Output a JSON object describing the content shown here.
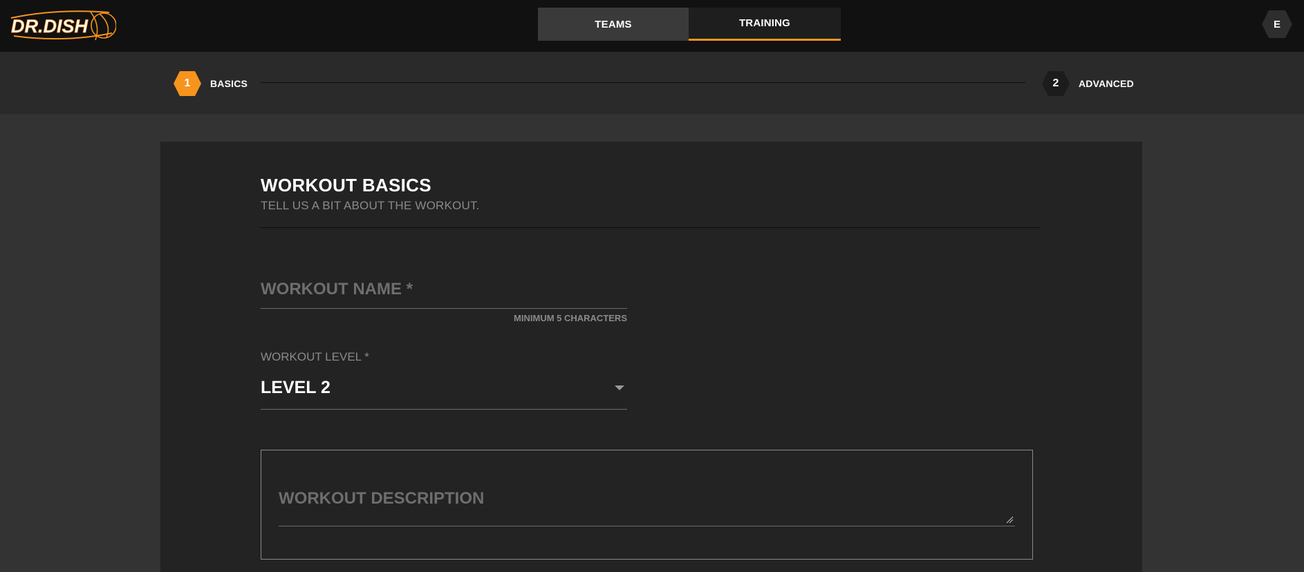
{
  "brand": {
    "logo_text": "DR.DISH",
    "accent_color": "#f7941d"
  },
  "nav": {
    "tabs": [
      {
        "label": "TEAMS",
        "active": false
      },
      {
        "label": "TRAINING",
        "active": true
      }
    ]
  },
  "user": {
    "avatar_initial": "E"
  },
  "stepper": {
    "steps": [
      {
        "number": "1",
        "label": "BASICS",
        "active": true
      },
      {
        "number": "2",
        "label": "ADVANCED",
        "active": false
      }
    ]
  },
  "form": {
    "title": "WORKOUT BASICS",
    "subtitle": "TELL US A BIT ABOUT THE WORKOUT.",
    "workout_name": {
      "placeholder": "WORKOUT NAME *",
      "value": "",
      "hint": "MINIMUM 5 CHARACTERS"
    },
    "workout_level": {
      "label": "WORKOUT LEVEL *",
      "value": "LEVEL 2"
    },
    "workout_description": {
      "placeholder": "WORKOUT DESCRIPTION",
      "value": ""
    }
  }
}
